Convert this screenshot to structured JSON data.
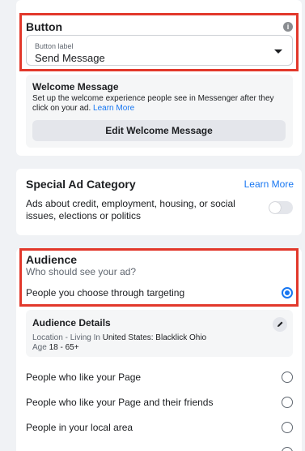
{
  "button_section": {
    "title": "Button",
    "info_icon": "info-icon",
    "select": {
      "label": "Button label",
      "value": "Send Message"
    },
    "welcome": {
      "title": "Welcome Message",
      "description": "Set up the welcome experience people see in Messenger after they click on your ad.",
      "learn_more": "Learn More",
      "button_label": "Edit Welcome Message"
    }
  },
  "special_ad": {
    "title": "Special Ad Category",
    "learn_more": "Learn More",
    "description": "Ads about credit, employment, housing, or social issues, elections or politics",
    "toggle_on": false
  },
  "audience": {
    "title": "Audience",
    "subtitle": "Who should see your ad?",
    "selected_option": "People you choose through targeting",
    "details": {
      "title": "Audience Details",
      "location_prefix": "Location - Living In ",
      "location_value": "United States: Blacklick Ohio",
      "age_prefix": "Age ",
      "age_value": "18 - 65+"
    },
    "options": [
      "People who like your Page",
      "People who like your Page and their friends",
      "People in your local area"
    ]
  },
  "colors": {
    "accent": "#1877f2",
    "highlight": "#e2382b"
  }
}
